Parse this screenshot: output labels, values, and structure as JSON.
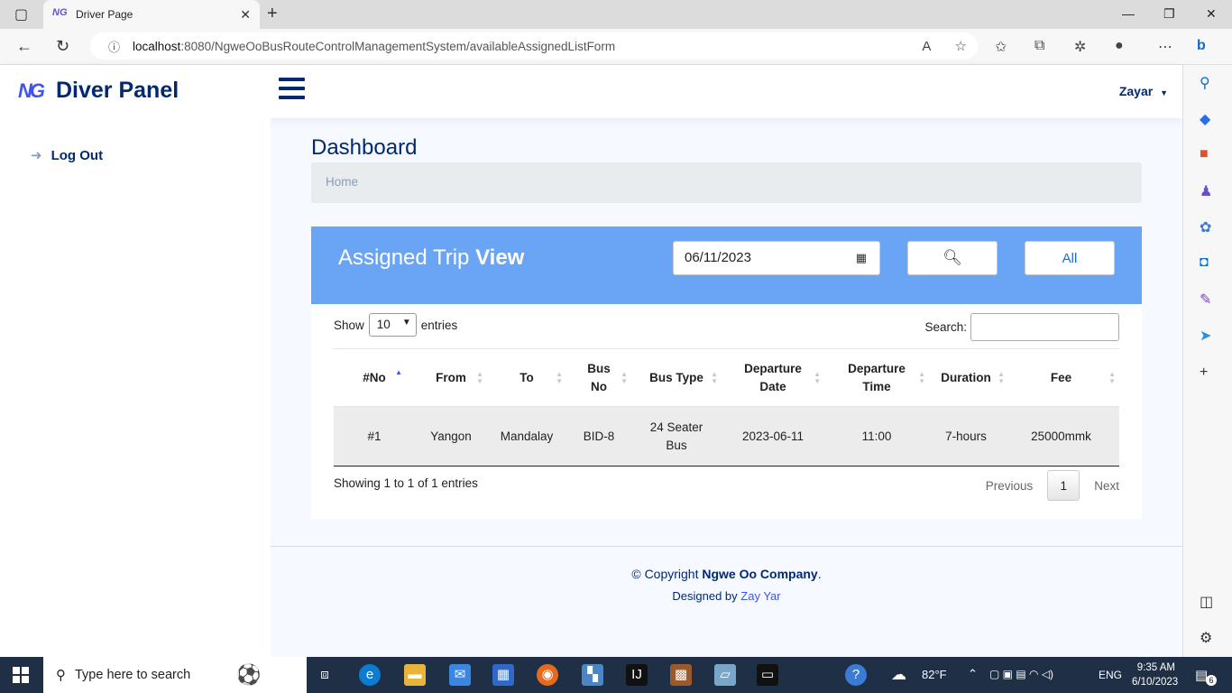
{
  "browser": {
    "tab_title": "Driver Page",
    "url_host": "localhost",
    "url_rest": ":8080/NgweOoBusRouteControlManagementSystem/availableAssignedListForm"
  },
  "header": {
    "logo_mark": "NG",
    "logo_text": "Diver Panel",
    "user_name": "Zayar"
  },
  "sidebar": {
    "logout_label": "Log Out"
  },
  "main": {
    "page_title": "Dashboard",
    "breadcrumb": "Home",
    "card_title_part1": "Assigned Trip ",
    "card_title_part2": "View",
    "date_value": "06/11/2023",
    "all_button": "All",
    "show_label": "Show",
    "entries_value": "10",
    "entries_label": "entries",
    "search_label": "Search:",
    "columns": [
      "#No",
      "From",
      "To",
      "Bus No",
      "Bus Type",
      "Departure Date",
      "Departure Time",
      "Duration",
      "Fee"
    ],
    "rows": [
      [
        "#1",
        "Yangon",
        "Mandalay",
        "BID-8",
        "24 Seater Bus",
        "2023-06-11",
        "11:00",
        "7-hours",
        "25000mmk"
      ]
    ],
    "info_text": "Showing 1 to 1 of 1 entries",
    "pager_prev": "Previous",
    "pager_current": "1",
    "pager_next": "Next"
  },
  "footer": {
    "copyright_prefix": "© Copyright ",
    "company": "Ngwe Oo Company",
    "copyright_suffix": ".",
    "designed_prefix": "Designed by ",
    "designer": "Zay Yar"
  },
  "taskbar": {
    "search_placeholder": "Type here to search",
    "temperature": "82°F",
    "language": "ENG",
    "time": "9:35 AM",
    "date": "6/10/2023",
    "notification_count": "6"
  },
  "colors": {
    "brand": "#012970",
    "card_header": "#6aa4f5",
    "accent": "#4154f1"
  }
}
